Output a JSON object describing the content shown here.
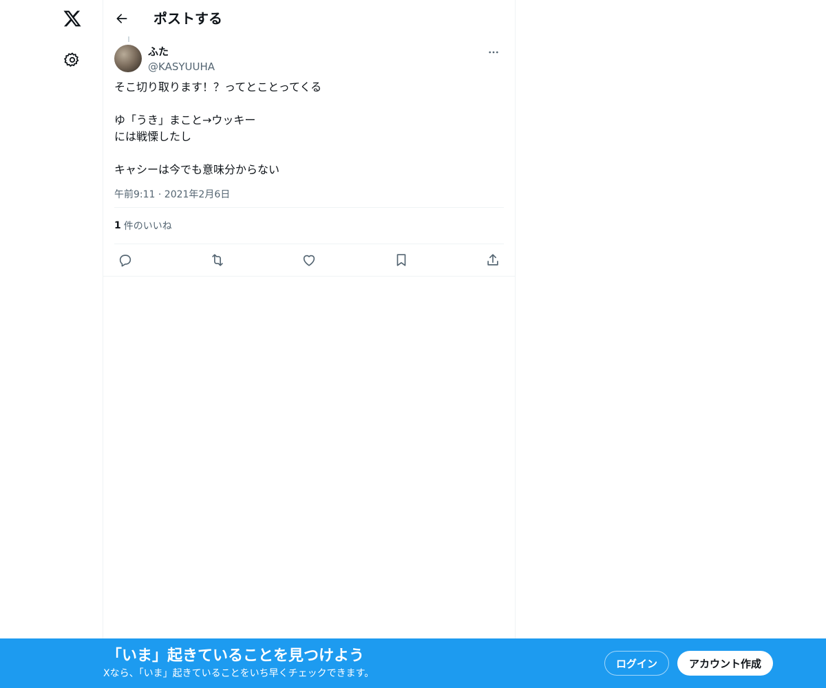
{
  "nav": {
    "logo_icon": "x-logo-icon",
    "settings_icon": "gear-icon"
  },
  "header": {
    "title": "ポストする",
    "back_icon": "arrow-left-icon"
  },
  "post": {
    "author_name": "ふた",
    "author_handle": "@KASYUUHA",
    "text": "そこ切り取ります！？ってとことってくる\n\nゆ「うき」まこと→ウッキー\nには戦慄したし\n\nキャシーは今でも意味分からない",
    "timestamp": "午前9:11 · 2021年2月6日",
    "likes_count": "1",
    "likes_label": "件のいいね",
    "action_icons": [
      "reply-icon",
      "repost-icon",
      "like-icon",
      "bookmark-icon",
      "share-icon"
    ]
  },
  "banner": {
    "title": "「いま」起きていることを見つけよう",
    "subtitle": "Xなら、「いま」起きていることをいち早くチェックできます。",
    "login_label": "ログイン",
    "signup_label": "アカウント作成",
    "background_color": "#1d9bf0"
  }
}
